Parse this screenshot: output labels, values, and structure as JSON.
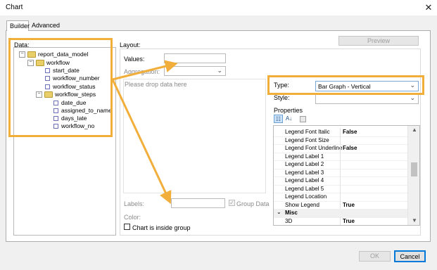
{
  "window": {
    "title": "Chart",
    "close_glyph": "✕"
  },
  "tabs": [
    {
      "label": "Builder"
    },
    {
      "label": "Advanced"
    }
  ],
  "data_panel": {
    "label": "Data:",
    "tree": {
      "root": "report_data_model",
      "workflow": "workflow",
      "workflow_children": [
        "start_date",
        "workflow_number",
        "workflow_status"
      ],
      "steps": "workflow_steps",
      "steps_children": [
        "date_due",
        "assigned_to_name",
        "days_late",
        "workflow_no"
      ]
    }
  },
  "layout": {
    "label": "Layout:",
    "values_label": "Values:",
    "aggregation_label": "Aggregation:",
    "drop_hint": "Please drop data here",
    "labels_label": "Labels:",
    "group_data_label": "Group Data",
    "color_label": "Color:",
    "inside_group_label": "Chart is inside group"
  },
  "preview_button": "Preview",
  "type_row": {
    "label": "Type:",
    "value": "Bar Graph - Vertical"
  },
  "style_row": {
    "label": "Style:",
    "value": ""
  },
  "properties": {
    "label": "Properties",
    "rows": [
      {
        "name": "Legend Font Italic",
        "value": "False"
      },
      {
        "name": "Legend Font Size",
        "value": ""
      },
      {
        "name": "Legend Font Underline",
        "value": "False"
      },
      {
        "name": "Legend Label 1",
        "value": ""
      },
      {
        "name": "Legend Label 2",
        "value": ""
      },
      {
        "name": "Legend Label 3",
        "value": ""
      },
      {
        "name": "Legend Label 4",
        "value": ""
      },
      {
        "name": "Legend Label 5",
        "value": ""
      },
      {
        "name": "Legend Location",
        "value": ""
      },
      {
        "name": "Show Legend",
        "value": "True"
      }
    ],
    "category": "Misc",
    "misc_rows": [
      {
        "name": "3D",
        "value": "True"
      }
    ]
  },
  "footer": {
    "ok": "OK",
    "cancel": "Cancel"
  },
  "colors": {
    "annotation_orange": "#f2ae3b",
    "accent_blue": "#0078d7"
  }
}
